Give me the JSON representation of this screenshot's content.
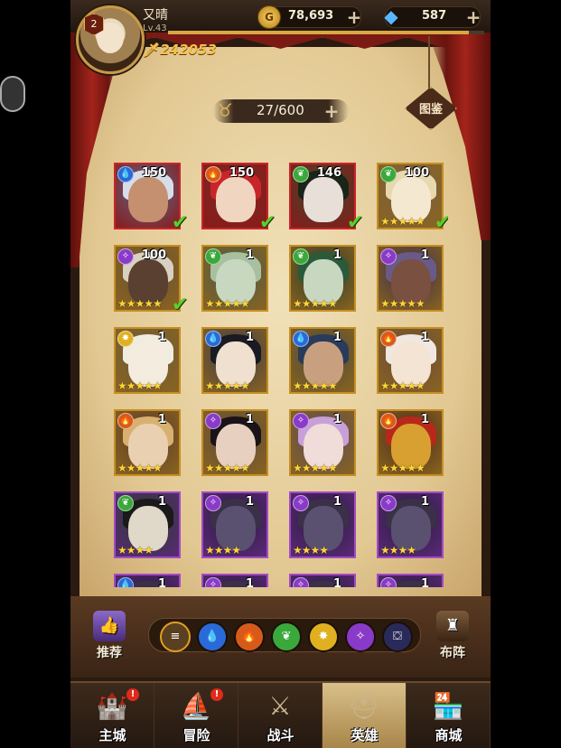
{
  "player": {
    "name": "又晴",
    "level": "Lv.43",
    "rank_badge": "2",
    "power": "242053",
    "xp_fraction": 0.95
  },
  "resources": {
    "gold": "78,693",
    "gems": "587"
  },
  "heroes_count": "27/600",
  "codex_label": "图鉴",
  "heroes": [
    {
      "level": "150",
      "element": "water",
      "frame": "red",
      "stars": 0,
      "deployed": true,
      "bg": "#5a6a8a",
      "hair": "#d8dde8",
      "skin": "#c49070"
    },
    {
      "level": "150",
      "element": "fire",
      "frame": "red",
      "stars": 0,
      "deployed": true,
      "bg": "#7a2a22",
      "hair": "#c8252a",
      "skin": "#f0d6c0"
    },
    {
      "level": "146",
      "element": "nature",
      "frame": "red",
      "stars": 0,
      "deployed": true,
      "bg": "#3a4a2a",
      "hair": "#1a2418",
      "skin": "#e8e0d8"
    },
    {
      "level": "100",
      "element": "nature",
      "frame": "gold",
      "stars": 5,
      "deployed": true,
      "bg": "#7a6040",
      "hair": "#e8d8b0",
      "skin": "#f4e8d0"
    },
    {
      "level": "100",
      "element": "arcane",
      "frame": "gold",
      "stars": 5,
      "deployed": true,
      "bg": "#6a5030",
      "hair": "#d8d0c0",
      "skin": "#5a4030"
    },
    {
      "level": "1",
      "element": "nature",
      "frame": "gold",
      "stars": 5,
      "deployed": false,
      "bg": "#4a5a4a",
      "hair": "#a8c0a0",
      "skin": "#c8d8c0"
    },
    {
      "level": "1",
      "element": "nature",
      "frame": "gold",
      "stars": 5,
      "deployed": false,
      "bg": "#2a3a2a",
      "hair": "#2a5a3a",
      "skin": "#c8d8c0"
    },
    {
      "level": "1",
      "element": "arcane",
      "frame": "gold",
      "stars": 5,
      "deployed": false,
      "bg": "#3a2a4a",
      "hair": "#6a5a8a",
      "skin": "#7a5040"
    },
    {
      "level": "1",
      "element": "light",
      "frame": "gold",
      "stars": 5,
      "deployed": false,
      "bg": "#6a5a3a",
      "hair": "#f0ece0",
      "skin": "#f4ecde"
    },
    {
      "level": "1",
      "element": "water",
      "frame": "gold",
      "stars": 5,
      "deployed": false,
      "bg": "#3a3a4a",
      "hair": "#1a1a22",
      "skin": "#f0e0d0"
    },
    {
      "level": "1",
      "element": "water",
      "frame": "gold",
      "stars": 5,
      "deployed": false,
      "bg": "#4a4a3a",
      "hair": "#2a3a5a",
      "skin": "#c8a080"
    },
    {
      "level": "1",
      "element": "fire",
      "frame": "gold",
      "stars": 5,
      "deployed": false,
      "bg": "#6a4a3a",
      "hair": "#f0e8e0",
      "skin": "#f4e4d4"
    },
    {
      "level": "1",
      "element": "fire",
      "frame": "gold",
      "stars": 5,
      "deployed": false,
      "bg": "#5a3a2a",
      "hair": "#d8b070",
      "skin": "#e8d0b0"
    },
    {
      "level": "1",
      "element": "arcane",
      "frame": "gold",
      "stars": 5,
      "deployed": false,
      "bg": "#5a4a3a",
      "hair": "#1a1418",
      "skin": "#e8d0c0"
    },
    {
      "level": "1",
      "element": "arcane",
      "frame": "gold",
      "stars": 5,
      "deployed": false,
      "bg": "#5a4a5a",
      "hair": "#c8a0d8",
      "skin": "#f0dcd8"
    },
    {
      "level": "1",
      "element": "fire",
      "frame": "gold",
      "stars": 5,
      "deployed": false,
      "bg": "#4a2a1a",
      "hair": "#b8281a",
      "skin": "#d8a030"
    },
    {
      "level": "1",
      "element": "nature",
      "frame": "purple",
      "stars": 4,
      "deployed": false,
      "bg": "#2a3a2a",
      "hair": "#1a1a1a",
      "skin": "#e0d8c8"
    },
    {
      "level": "1",
      "element": "arcane",
      "frame": "purple",
      "stars": 4,
      "deployed": false,
      "bg": "#2a1a3a",
      "hair": "#3a3048",
      "skin": "#5a5070"
    },
    {
      "level": "1",
      "element": "arcane",
      "frame": "purple",
      "stars": 4,
      "deployed": false,
      "bg": "#2a1a3a",
      "hair": "#3a3048",
      "skin": "#5a5070"
    },
    {
      "level": "1",
      "element": "arcane",
      "frame": "purple",
      "stars": 4,
      "deployed": false,
      "bg": "#2a1a3a",
      "hair": "#3a3048",
      "skin": "#5a5070"
    },
    {
      "level": "1",
      "element": "water",
      "frame": "purple",
      "stars": 0,
      "deployed": false,
      "bg": "#2a1a3a",
      "hair": "#3a3048",
      "skin": "#5a5070"
    },
    {
      "level": "1",
      "element": "arcane",
      "frame": "purple",
      "stars": 0,
      "deployed": false,
      "bg": "#2a1a3a",
      "hair": "#3a3048",
      "skin": "#5a5070"
    },
    {
      "level": "1",
      "element": "arcane",
      "frame": "purple",
      "stars": 0,
      "deployed": false,
      "bg": "#2a1a3a",
      "hair": "#3a3048",
      "skin": "#5a5070"
    },
    {
      "level": "1",
      "element": "arcane",
      "frame": "purple",
      "stars": 0,
      "deployed": false,
      "bg": "#2a1a3a",
      "hair": "#3a3048",
      "skin": "#5a5070"
    }
  ],
  "element_colors": {
    "water": "#2a6ad8",
    "fire": "#d85a1a",
    "nature": "#3aa83a",
    "light": "#e0b020",
    "arcane": "#8a3ac8",
    "dark": "#2a2a5a"
  },
  "filters": [
    {
      "name": "all",
      "icon": "≡"
    },
    {
      "name": "water",
      "icon": "💧"
    },
    {
      "name": "fire",
      "icon": "🔥"
    },
    {
      "name": "nature",
      "icon": "❦"
    },
    {
      "name": "light",
      "icon": "✸"
    },
    {
      "name": "arcane",
      "icon": "✧"
    },
    {
      "name": "dark",
      "icon": "⛋"
    }
  ],
  "side_buttons": {
    "recommend": "推荐",
    "formation": "布阵"
  },
  "nav": [
    {
      "label": "主城",
      "icon": "🏰",
      "alert": true,
      "active": false
    },
    {
      "label": "冒险",
      "icon": "⛵",
      "alert": true,
      "active": false
    },
    {
      "label": "战斗",
      "icon": "⚔",
      "alert": false,
      "active": false
    },
    {
      "label": "英雄",
      "icon": "⛑",
      "alert": false,
      "active": true
    },
    {
      "label": "商城",
      "icon": "🏪",
      "alert": false,
      "active": false
    }
  ]
}
